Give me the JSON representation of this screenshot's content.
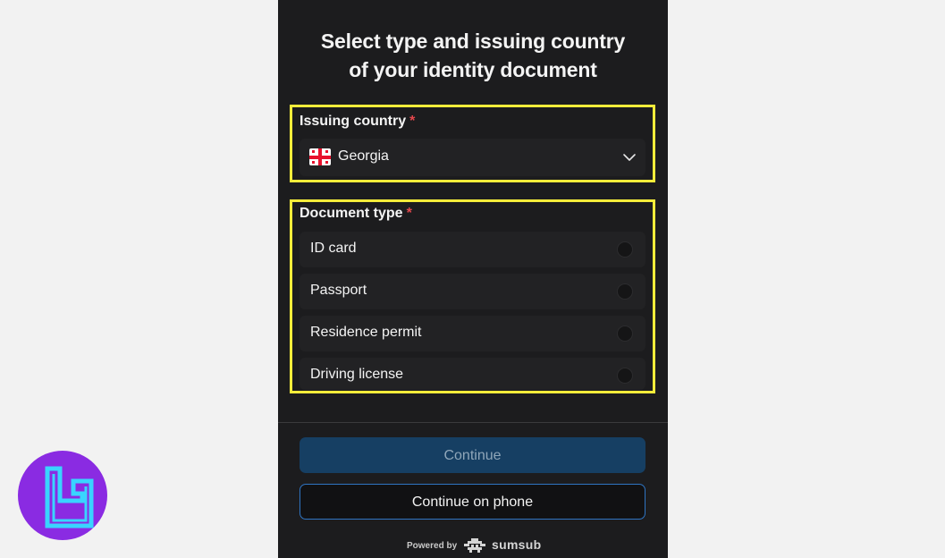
{
  "header": {
    "title_line1": "Select type and issuing country",
    "title_line2": "of your identity document"
  },
  "country": {
    "label": "Issuing country",
    "required_mark": "*",
    "selected": "Georgia",
    "flag_icon": "georgia-flag-icon"
  },
  "document_type": {
    "label": "Document type",
    "required_mark": "*",
    "options": [
      {
        "label": "ID card",
        "selected": false
      },
      {
        "label": "Passport",
        "selected": false
      },
      {
        "label": "Residence permit",
        "selected": false
      },
      {
        "label": "Driving license",
        "selected": false
      }
    ]
  },
  "actions": {
    "continue_label": "Continue",
    "continue_on_phone_label": "Continue on phone"
  },
  "footer": {
    "powered_by": "Powered by",
    "brand": "sumsub"
  },
  "colors": {
    "highlight": "#f4ec3a",
    "required": "#e5484d",
    "primary_button": "#163f63",
    "outline_border": "#2f74c2",
    "corner_logo_bg": "#8a2be2",
    "corner_logo_stroke": "#39d4ff"
  }
}
